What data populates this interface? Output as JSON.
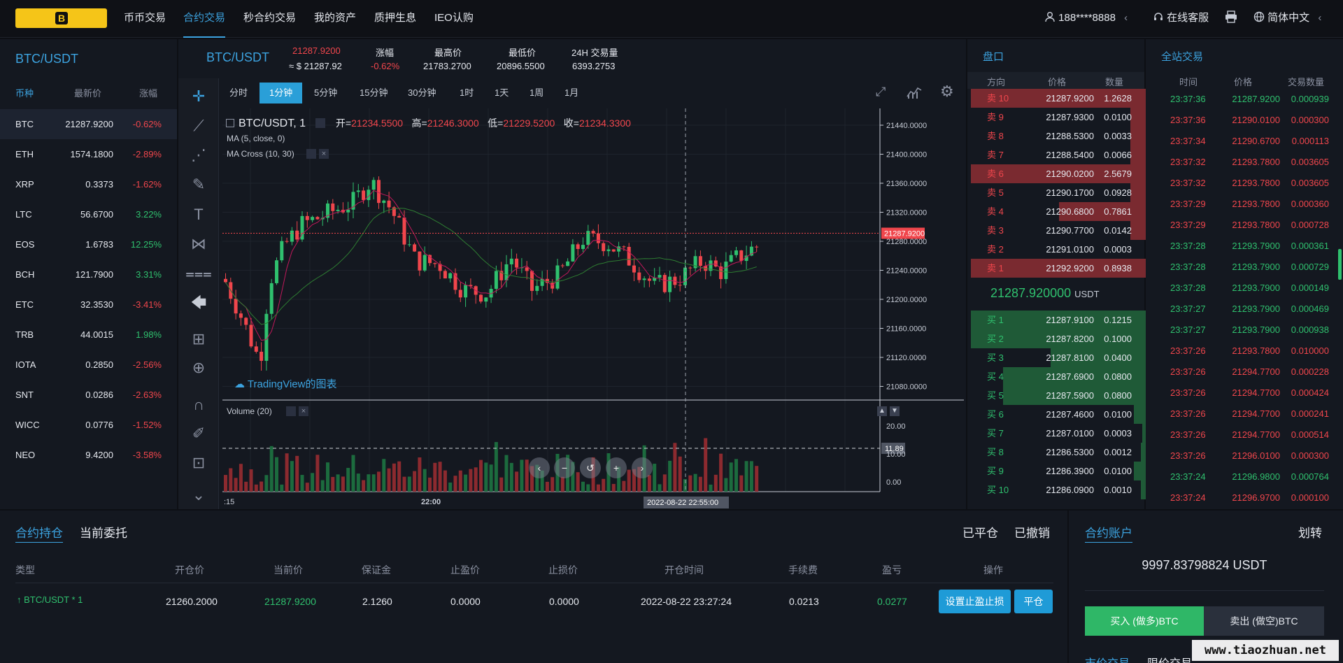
{
  "header": {
    "logo_letter": "B",
    "nav": [
      {
        "label": "币币交易"
      },
      {
        "label": "合约交易"
      },
      {
        "label": "秒合约交易"
      },
      {
        "label": "我的资产"
      },
      {
        "label": "质押生息"
      },
      {
        "label": "IEO认购"
      }
    ],
    "active_nav": "合约交易",
    "user": "188****8888",
    "user_chevron": "‹",
    "support": "在线客服",
    "language": "简体中文"
  },
  "market_list": {
    "title": "BTC/USDT",
    "columns": [
      "币种",
      "最新价",
      "涨幅"
    ],
    "rows": [
      {
        "coin": "BTC",
        "price": "21287.9200",
        "change": "-0.62%",
        "up": false
      },
      {
        "coin": "ETH",
        "price": "1574.1800",
        "change": "-2.89%",
        "up": false
      },
      {
        "coin": "XRP",
        "price": "0.3373",
        "change": "-1.62%",
        "up": false
      },
      {
        "coin": "LTC",
        "price": "56.6700",
        "change": "3.22%",
        "up": true
      },
      {
        "coin": "EOS",
        "price": "1.6783",
        "change": "12.25%",
        "up": true
      },
      {
        "coin": "BCH",
        "price": "121.7900",
        "change": "3.31%",
        "up": true
      },
      {
        "coin": "ETC",
        "price": "32.3530",
        "change": "-3.41%",
        "up": false
      },
      {
        "coin": "TRB",
        "price": "44.0015",
        "change": "1.98%",
        "up": true
      },
      {
        "coin": "IOTA",
        "price": "0.2850",
        "change": "-2.56%",
        "up": false
      },
      {
        "coin": "SNT",
        "price": "0.0286",
        "change": "-2.63%",
        "up": false
      },
      {
        "coin": "WICC",
        "price": "0.0776",
        "change": "-1.52%",
        "up": false
      },
      {
        "coin": "NEO",
        "price": "9.4200",
        "change": "-3.58%",
        "up": false
      }
    ]
  },
  "ticker": {
    "pair": "BTC/USDT",
    "last": "21287.9200",
    "last_usd": "≈ $ 21287.92",
    "change_label": "涨幅",
    "change": "-0.62%",
    "high_label": "最高价",
    "high": "21783.2700",
    "low_label": "最低价",
    "low": "20896.5500",
    "vol_label": "24H 交易量",
    "vol": "6393.2753"
  },
  "chart": {
    "timeframes": [
      "分时",
      "1分钟",
      "5分钟",
      "15分钟",
      "30分钟",
      "1时",
      "1天",
      "1周",
      "1月"
    ],
    "active_timeframe": "1分钟",
    "symbol": "BTC/USDT, 1",
    "o_label": "开=",
    "o": "21234.5500",
    "h_label": "高=",
    "h": "21246.3000",
    "l_label": "低=",
    "l": "21229.5200",
    "c_label": "收=",
    "c": "21234.3300",
    "ma": "MA (5, close, 0)",
    "ma_cross": "MA Cross (10, 30)",
    "watermark": "TradingView的图表",
    "price_axis": [
      "21440.0000",
      "21400.0000",
      "21360.0000",
      "21320.0000",
      "21280.0000",
      "21240.0000",
      "21200.0000",
      "21160.0000",
      "21120.0000",
      "21080.0000"
    ],
    "last_price_tag": "21287.9200",
    "volume_title": "Volume (20)",
    "vol_axis": [
      "20.00",
      "10.00",
      "0.00"
    ],
    "vol_tag": "11.89",
    "time_axis": [
      ":15",
      "22:00"
    ],
    "crosshair_time": "2022-08-22 22:55:00",
    "colors": {
      "up": "#2fc06e",
      "down": "#f0464c",
      "accent": "#3ca3e0"
    }
  },
  "orderbook": {
    "title": "盘口",
    "columns": [
      "方向",
      "价格",
      "数量"
    ],
    "asks": [
      {
        "side": "卖 10",
        "price": "21287.9200",
        "qty": "1.2628",
        "depth": 1.0
      },
      {
        "side": "卖 9",
        "price": "21287.9300",
        "qty": "0.0100",
        "depth": 0.1
      },
      {
        "side": "卖 8",
        "price": "21288.5300",
        "qty": "0.0033",
        "depth": 0.1
      },
      {
        "side": "卖 7",
        "price": "21288.5400",
        "qty": "0.0066",
        "depth": 0.1
      },
      {
        "side": "卖 6",
        "price": "21290.0200",
        "qty": "2.5679",
        "depth": 1.0
      },
      {
        "side": "卖 5",
        "price": "21290.1700",
        "qty": "0.0928",
        "depth": 0.1
      },
      {
        "side": "卖 4",
        "price": "21290.6800",
        "qty": "0.7861",
        "depth": 0.5
      },
      {
        "side": "卖 3",
        "price": "21290.7700",
        "qty": "0.0142",
        "depth": 0.1
      },
      {
        "side": "卖 2",
        "price": "21291.0100",
        "qty": "0.0003",
        "depth": 0.0
      },
      {
        "side": "卖 1",
        "price": "21292.9200",
        "qty": "0.8938",
        "depth": 1.0
      }
    ],
    "mid_price": "21287.920000",
    "mid_unit": "USDT",
    "bids": [
      {
        "side": "买 1",
        "price": "21287.9100",
        "qty": "0.1215",
        "depth": 1.0
      },
      {
        "side": "买 2",
        "price": "21287.8200",
        "qty": "0.1000",
        "depth": 1.0
      },
      {
        "side": "买 3",
        "price": "21287.8100",
        "qty": "0.0400",
        "depth": 0.55
      },
      {
        "side": "买 4",
        "price": "21287.6900",
        "qty": "0.0800",
        "depth": 0.82
      },
      {
        "side": "买 5",
        "price": "21287.5900",
        "qty": "0.0800",
        "depth": 0.82
      },
      {
        "side": "买 6",
        "price": "21287.4600",
        "qty": "0.0100",
        "depth": 0.08
      },
      {
        "side": "买 7",
        "price": "21287.0100",
        "qty": "0.0003",
        "depth": 0.03
      },
      {
        "side": "买 8",
        "price": "21286.5300",
        "qty": "0.0012",
        "depth": 0.04
      },
      {
        "side": "买 9",
        "price": "21286.3900",
        "qty": "0.0100",
        "depth": 0.08
      },
      {
        "side": "买 10",
        "price": "21286.0900",
        "qty": "0.0010",
        "depth": 0.04
      }
    ]
  },
  "trades": {
    "title": "全站交易",
    "columns": [
      "时间",
      "价格",
      "交易数量"
    ],
    "rows": [
      {
        "time": "23:37:36",
        "price": "21287.9200",
        "qty": "0.000939",
        "up": true
      },
      {
        "time": "23:37:36",
        "price": "21290.0100",
        "qty": "0.000300",
        "up": false
      },
      {
        "time": "23:37:34",
        "price": "21290.6700",
        "qty": "0.000113",
        "up": false
      },
      {
        "time": "23:37:32",
        "price": "21293.7800",
        "qty": "0.003605",
        "up": false
      },
      {
        "time": "23:37:32",
        "price": "21293.7800",
        "qty": "0.003605",
        "up": false
      },
      {
        "time": "23:37:29",
        "price": "21293.7800",
        "qty": "0.000360",
        "up": false
      },
      {
        "time": "23:37:29",
        "price": "21293.7800",
        "qty": "0.000728",
        "up": false
      },
      {
        "time": "23:37:28",
        "price": "21293.7900",
        "qty": "0.000361",
        "up": true
      },
      {
        "time": "23:37:28",
        "price": "21293.7900",
        "qty": "0.000729",
        "up": true
      },
      {
        "time": "23:37:28",
        "price": "21293.7900",
        "qty": "0.000149",
        "up": true
      },
      {
        "time": "23:37:27",
        "price": "21293.7900",
        "qty": "0.000469",
        "up": true
      },
      {
        "time": "23:37:27",
        "price": "21293.7900",
        "qty": "0.000938",
        "up": true
      },
      {
        "time": "23:37:26",
        "price": "21293.7800",
        "qty": "0.010000",
        "up": false
      },
      {
        "time": "23:37:26",
        "price": "21294.7700",
        "qty": "0.000228",
        "up": false
      },
      {
        "time": "23:37:26",
        "price": "21294.7700",
        "qty": "0.000424",
        "up": false
      },
      {
        "time": "23:37:26",
        "price": "21294.7700",
        "qty": "0.000241",
        "up": false
      },
      {
        "time": "23:37:26",
        "price": "21294.7700",
        "qty": "0.000514",
        "up": false
      },
      {
        "time": "23:37:26",
        "price": "21296.0100",
        "qty": "0.000300",
        "up": false
      },
      {
        "time": "23:37:24",
        "price": "21296.9800",
        "qty": "0.000764",
        "up": true
      },
      {
        "time": "23:37:24",
        "price": "21296.9700",
        "qty": "0.000100",
        "up": false
      }
    ]
  },
  "positions": {
    "tab_active": "合约持仓",
    "tab_other": "当前委托",
    "closed": "已平仓",
    "cancelled": "已撤销",
    "columns": [
      "类型",
      "开仓价",
      "当前价",
      "保证金",
      "止盈价",
      "止损价",
      "开仓时间",
      "手续费",
      "盈亏",
      "操作"
    ],
    "row": {
      "type": "BTC/USDT * 1",
      "open": "21260.2000",
      "current": "21287.9200",
      "margin": "2.1260",
      "tp": "0.0000",
      "sl": "0.0000",
      "time": "2022-08-22 23:27:24",
      "fee": "0.0213",
      "pnl": "0.0277",
      "btn_tpsl": "设置止盈止损",
      "btn_close": "平仓"
    }
  },
  "account": {
    "title": "合约账户",
    "transfer": "划转",
    "balance": "9997.83798824 USDT",
    "buy": "买入 (做多)BTC",
    "sell": "卖出 (做空)BTC",
    "market_tab": "市价交易",
    "limit_tab": "限价交易"
  },
  "watermark_text": "www.tiaozhuan.net"
}
